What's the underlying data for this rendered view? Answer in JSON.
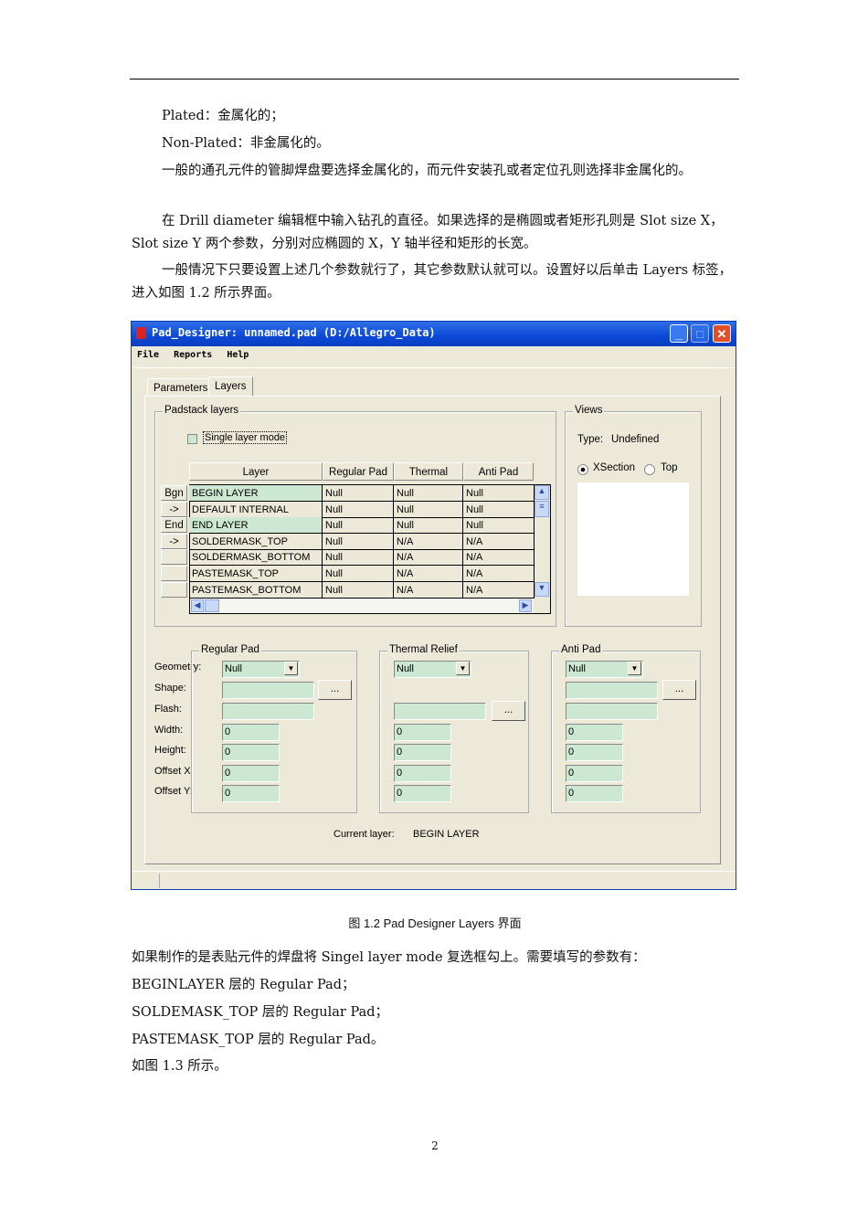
{
  "body_top": [
    "Plated：金属化的；",
    "Non-Plated：非金属化的。",
    "一般的通孔元件的管脚焊盘要选择金属化的，而元件安装孔或者定位孔则选择非金属化的。",
    "在 Drill diameter 编辑框中输入钻孔的直径。如果选择的是椭圆或者矩形孔则是 Slot size X，Slot size Y 两个参数，分别对应椭圆的 X，Y 轴半径和矩形的长宽。",
    "一般情况下只要设置上述几个参数就行了，其它参数默认就可以。设置好以后单击 Layers 标签，进入如图 1.2 所示界面。"
  ],
  "window": {
    "title": "Pad_Designer: unnamed.pad (D:/Allegro_Data)",
    "buttons": {
      "minimize": "_",
      "maximize": "□",
      "close": "✕"
    },
    "menu": [
      "File",
      "Reports",
      "Help"
    ],
    "tabs": [
      "Parameters",
      "Layers"
    ],
    "padstack_group": "Padstack layers",
    "single_layer_mode": "Single layer mode",
    "columns": [
      "Layer",
      "Regular Pad",
      "Thermal Relief",
      "Anti Pad"
    ],
    "rows": [
      {
        "btn": "Bgn",
        "layer": "BEGIN LAYER",
        "regular": "Null",
        "thermal": "Null",
        "anti": "Null",
        "hl": true
      },
      {
        "btn": "->",
        "layer": "DEFAULT INTERNAL",
        "regular": "Null",
        "thermal": "Null",
        "anti": "Null",
        "hl": false
      },
      {
        "btn": "End",
        "layer": "END LAYER",
        "regular": "Null",
        "thermal": "Null",
        "anti": "Null",
        "hl": true
      },
      {
        "btn": "->",
        "layer": "SOLDERMASK_TOP",
        "regular": "Null",
        "thermal": "N/A",
        "anti": "N/A",
        "hl": false
      },
      {
        "btn": "",
        "layer": "SOLDERMASK_BOTTOM",
        "regular": "Null",
        "thermal": "N/A",
        "anti": "N/A",
        "hl": false
      },
      {
        "btn": "",
        "layer": "PASTEMASK_TOP",
        "regular": "Null",
        "thermal": "N/A",
        "anti": "N/A",
        "hl": false
      },
      {
        "btn": "",
        "layer": "PASTEMASK_BOTTOM",
        "regular": "Null",
        "thermal": "N/A",
        "anti": "N/A",
        "hl": false
      }
    ],
    "views": {
      "title": "Views",
      "type_label": "Type:",
      "type_value": "Undefined",
      "radio_xsection": "XSection",
      "radio_top": "Top"
    },
    "field_labels": [
      "Geometry:",
      "Shape:",
      "Flash:",
      "Width:",
      "Height:",
      "Offset X:",
      "Offset Y:"
    ],
    "pad_groups": [
      {
        "title": "Regular Pad",
        "geometry": "Null",
        "width": "0",
        "height": "0",
        "offset_x": "0",
        "offset_y": "0"
      },
      {
        "title": "Thermal Relief",
        "geometry": "Null",
        "width": "0",
        "height": "0",
        "offset_x": "0",
        "offset_y": "0"
      },
      {
        "title": "Anti Pad",
        "geometry": "Null",
        "width": "0",
        "height": "0",
        "offset_x": "0",
        "offset_y": "0"
      }
    ],
    "browse_label": "...",
    "current_layer_label": "Current layer:",
    "current_layer_value": "BEGIN LAYER"
  },
  "caption": "图 1.2   Pad Designer Layers 界面",
  "body_bottom": [
    "如果制作的是表贴元件的焊盘将 Singel layer mode 复选框勾上。需要填写的参数有：",
    "BEGINLAYER 层的 Regular Pad；",
    "SOLDEMASK_TOP 层的 Regular Pad；",
    "PASTEMASK_TOP 层的 Regular Pad。",
    "如图 1.3 所示。"
  ],
  "page_number": "2"
}
